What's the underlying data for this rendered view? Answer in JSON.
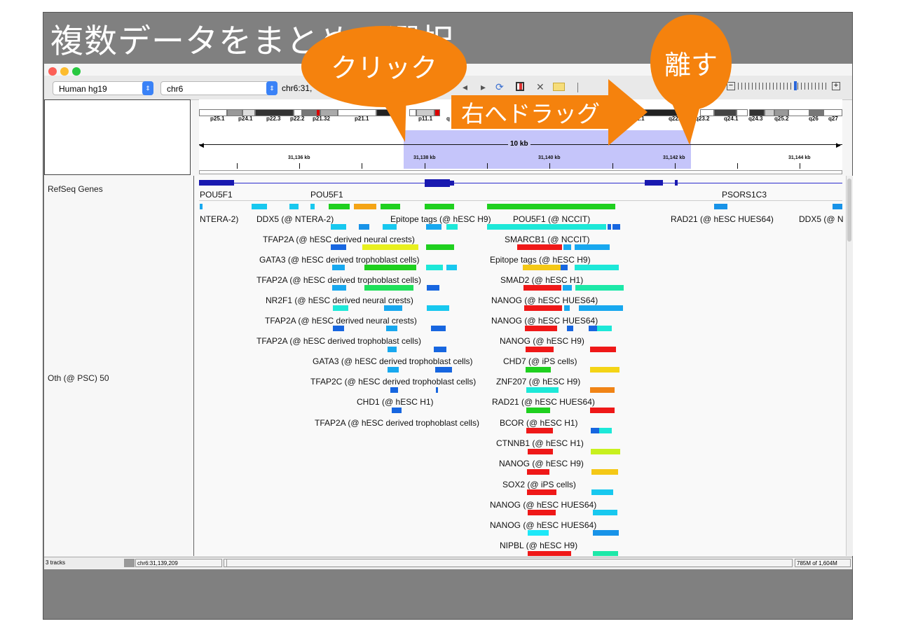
{
  "slide": {
    "title": "複数データをまとめて選択"
  },
  "callouts": {
    "click": "クリック",
    "release": "離す",
    "drag": "右へドラッグ"
  },
  "toolbar": {
    "genome": "Human hg19",
    "chromosome": "chr6",
    "locus": "chr6:31,"
  },
  "ideogram": {
    "bands": [
      "p25.1",
      "p24.1",
      "p22.3",
      "p22.2",
      "p21.32",
      "p21.1",
      "p11.1",
      "q",
      "22.1",
      "q22.3",
      "q23.2",
      "q24.1",
      "q24.3",
      "q25.2",
      "q26",
      "q27"
    ]
  },
  "ruler": {
    "span": "10 kb",
    "ticks": [
      "31,136 kb",
      "31,138 kb",
      "31,140 kb",
      "31,142 kb",
      "31,144 kb"
    ]
  },
  "tracks": {
    "refseq": "RefSeq Genes",
    "oth": "Oth (@ PSC) 50"
  },
  "genes": [
    "POU5F1",
    "POU5F1",
    "PSORS1C3"
  ],
  "peak_labels": {
    "row1": [
      "NTERA-2)",
      "DDX5 (@ NTERA-2)",
      "Epitope tags (@ hESC H9)",
      "POU5F1 (@ NCCIT)",
      "RAD21 (@ hESC HUES64)",
      "DDX5 (@ N"
    ],
    "left": [
      "TFAP2A (@ hESC derived neural crests)",
      "GATA3 (@ hESC derived trophoblast cells)",
      "TFAP2A (@ hESC derived trophoblast cells)",
      "NR2F1 (@ hESC derived neural crests)",
      "TFAP2A (@ hESC derived neural crests)",
      "TFAP2A (@ hESC derived trophoblast cells)",
      "GATA3 (@ hESC derived trophoblast cells)",
      "TFAP2C (@ hESC derived trophoblast cells)",
      "CHD1 (@ hESC H1)",
      "TFAP2A (@ hESC derived trophoblast cells)"
    ],
    "right": [
      "SMARCB1 (@ NCCIT)",
      "Epitope tags (@ hESC H9)",
      "SMAD2 (@ hESC H1)",
      "NANOG (@ hESC HUES64)",
      "NANOG (@ hESC HUES64)",
      "NANOG (@ hESC H9)",
      "CHD7 (@ iPS cells)",
      "ZNF207 (@ hESC H9)",
      "RAD21 (@ hESC HUES64)",
      "BCOR (@ hESC H1)",
      "CTNNB1 (@ hESC H1)",
      "NANOG (@ hESC H9)",
      "SOX2 (@ iPS cells)",
      "NANOG (@ hESC HUES64)",
      "NANOG (@ hESC HUES64)",
      "NIPBL (@ hESC H9)"
    ]
  },
  "status": {
    "tracks": "3 tracks",
    "position": "chr6:31,139,209",
    "memory": "785M of 1,604M"
  }
}
